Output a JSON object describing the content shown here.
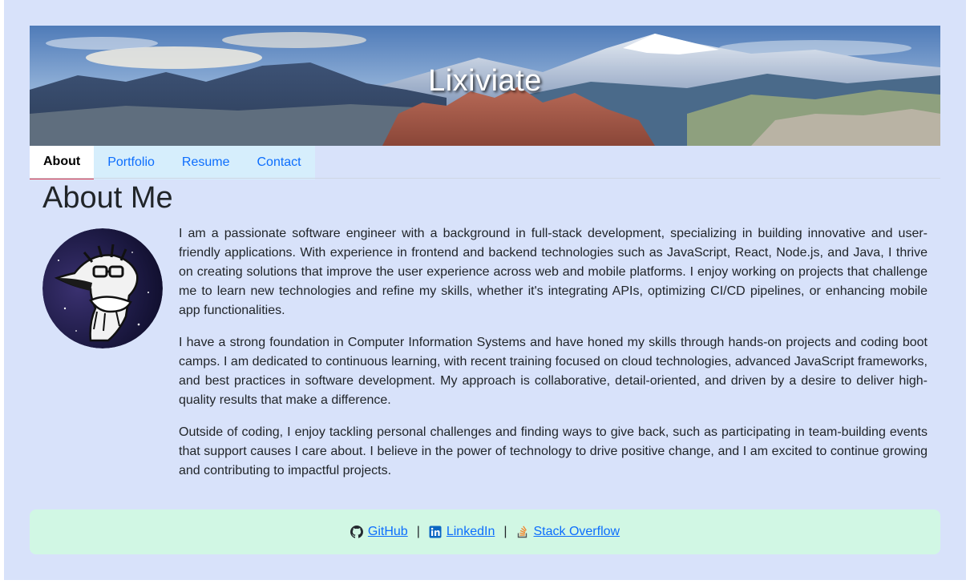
{
  "site": {
    "title": "Lixiviate"
  },
  "tabs": [
    {
      "label": "About",
      "active": true
    },
    {
      "label": "Portfolio",
      "active": false
    },
    {
      "label": "Resume",
      "active": false
    },
    {
      "label": "Contact",
      "active": false
    }
  ],
  "about": {
    "heading": "About Me",
    "paragraphs": [
      "I am a passionate software engineer with a background in full-stack development, specializing in building innovative and user-friendly applications. With experience in frontend and backend technologies such as JavaScript, React, Node.js, and Java, I thrive on creating solutions that improve the user experience across web and mobile platforms. I enjoy working on projects that challenge me to learn new technologies and refine my skills, whether it's integrating APIs, optimizing CI/CD pipelines, or enhancing mobile app functionalities.",
      "I have a strong foundation in Computer Information Systems and have honed my skills through hands-on projects and coding boot camps. I am dedicated to continuous learning, with recent training focused on cloud technologies, advanced JavaScript frameworks, and best practices in software development. My approach is collaborative, detail-oriented, and driven by a desire to deliver high-quality results that make a difference.",
      "Outside of coding, I enjoy tackling personal challenges and finding ways to give back, such as participating in team-building events that support causes I care about. I believe in the power of technology to drive positive change, and I am excited to continue growing and contributing to impactful projects."
    ]
  },
  "footer": {
    "links": [
      {
        "label": "GitHub",
        "icon": "github-icon"
      },
      {
        "label": "LinkedIn",
        "icon": "linkedin-icon"
      },
      {
        "label": "Stack Overflow",
        "icon": "stackoverflow-icon"
      }
    ],
    "separator": "|"
  },
  "colors": {
    "page_background": "#d8e2fa",
    "link": "#0d6efd",
    "active_tab_underline": "#dc3545",
    "footer_background": "#d1f7e4"
  }
}
